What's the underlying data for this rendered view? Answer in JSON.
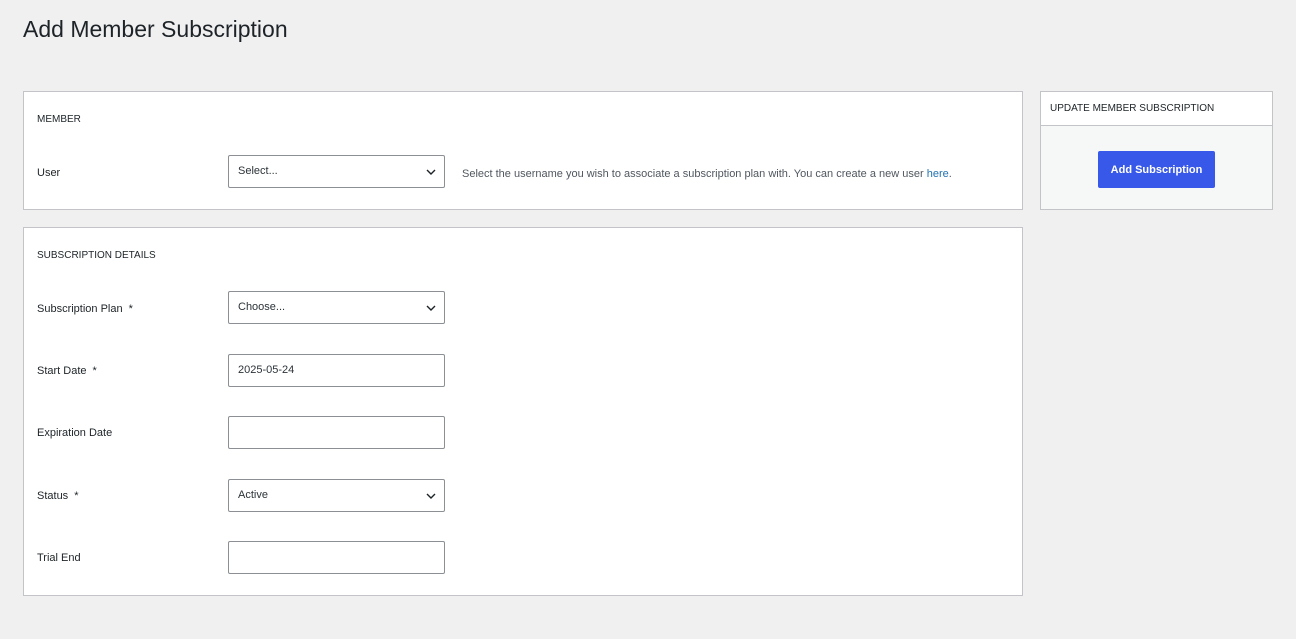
{
  "page": {
    "title": "Add Member Subscription"
  },
  "member_section": {
    "heading": "MEMBER",
    "user_label": "User",
    "user_select_value": "Select...",
    "help_text": "Select the username you wish to associate a subscription plan with. You can create a new user ",
    "help_link": "here",
    "help_end": "."
  },
  "details_section": {
    "heading": "SUBSCRIPTION DETAILS",
    "required_mark": "*",
    "plan_label": "Subscription Plan",
    "plan_value": "Choose...",
    "start_label": "Start Date",
    "start_value": "2025-05-24",
    "expiration_label": "Expiration Date",
    "expiration_value": "",
    "status_label": "Status",
    "status_value": "Active",
    "trial_label": "Trial End",
    "trial_value": ""
  },
  "side_panel": {
    "heading": "UPDATE MEMBER SUBSCRIPTION",
    "button_label": "Add Subscription"
  },
  "colors": {
    "background": "#f0f0f1",
    "card": "#ffffff",
    "border": "#c3c4c7",
    "primary_button": "#3858e9",
    "link": "#2271b1"
  },
  "icons": {
    "select_arrow": "chevron-down-icon"
  }
}
